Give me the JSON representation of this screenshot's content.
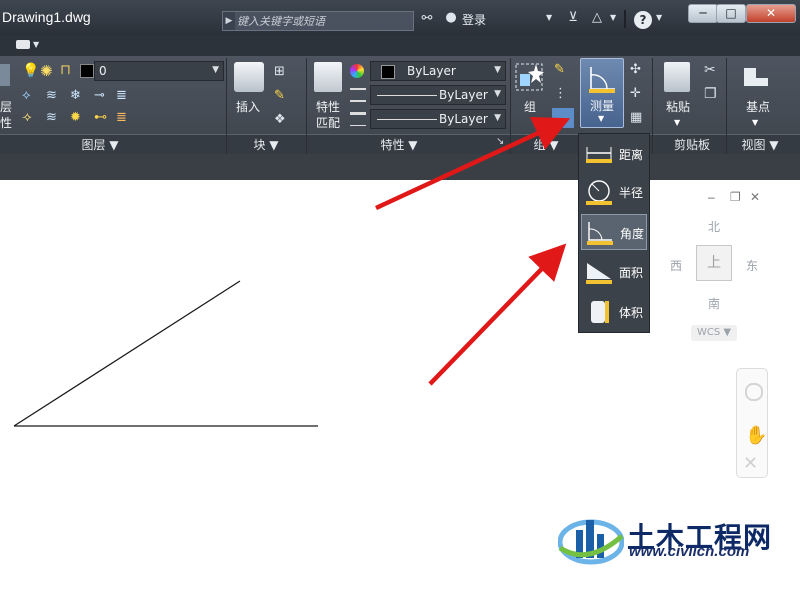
{
  "window": {
    "title": "Drawing1.dwg",
    "search_placeholder": "键入关键字或短语",
    "login_label": "登录",
    "help_label": "?",
    "minimize": "─",
    "maximize": "□",
    "close": "✕"
  },
  "ribbon": {
    "layer_value": "0",
    "insert_label": "插入",
    "props_match_label": [
      "特性",
      "匹配"
    ],
    "bylayer_color": "ByLayer",
    "bylayer_linetype": "ByLayer",
    "bylayer_lineweight": "ByLayer",
    "group_label": "组",
    "measure_label": "测量",
    "paste_label": "粘贴",
    "base_label": "基点",
    "left_partial": [
      "层",
      "性"
    ]
  },
  "panels": {
    "layers": "图层 ▼",
    "block": "块 ▼",
    "properties": "特性 ▼",
    "groups": "组 ▼",
    "clipboard": "剪贴板",
    "view": "视图 ▼"
  },
  "measure_menu": {
    "items": [
      "距离",
      "半径",
      "角度",
      "面积",
      "体积"
    ],
    "selected": "角度"
  },
  "viewcube": {
    "north": "北",
    "south": "南",
    "east": "东",
    "west": "西",
    "top": "上",
    "wcs": "WCS ▼"
  },
  "watermark": {
    "name": "土木工程网",
    "url": "www.civilcn.com"
  },
  "colors": {
    "title_bg": "#2a3038",
    "ribbon_bg": "#4e5560",
    "menu_bg": "#3c424a",
    "selected_bg": "#5a6470",
    "arrow_red": "#e01818"
  }
}
